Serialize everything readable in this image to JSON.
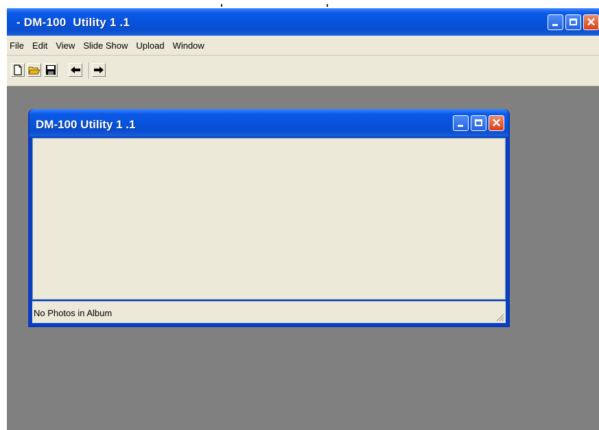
{
  "main_window": {
    "title": "- DM-100  Utility 1 .1",
    "caption_buttons": [
      "minimize-icon",
      "maximize-icon",
      "close-icon"
    ]
  },
  "menubar": {
    "items": [
      "File",
      "Edit",
      "View",
      "Slide Show",
      "Upload",
      "Window"
    ]
  },
  "toolbar": {
    "buttons": [
      "new-document-icon",
      "open-folder-icon",
      "save-disk-icon",
      "arrow-left-icon",
      "arrow-right-icon"
    ]
  },
  "child_window": {
    "title": "DM-100 Utility 1 .1",
    "status_text": "No Photos in Album"
  },
  "colors": {
    "titlebar_blue": "#0652da",
    "window_frame": "#0a3fc4",
    "face": "#ece9d8",
    "mdi_background": "#808080",
    "close_red": "#d8401b"
  }
}
